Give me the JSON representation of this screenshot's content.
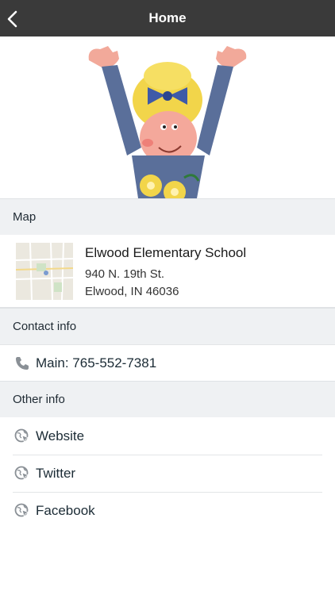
{
  "header": {
    "title": "Home",
    "back_icon": "chevron-left-icon"
  },
  "hero": {
    "alt": "school mascot illustration"
  },
  "map_section": {
    "heading": "Map",
    "school_name": "Elwood Elementary School",
    "address_line1": "940 N. 19th St.",
    "address_line2": "Elwood, IN 46036"
  },
  "contact_section": {
    "heading": "Contact info",
    "phone_label": "Main: 765-552-7381",
    "phone_icon": "phone-icon"
  },
  "other_section": {
    "heading": "Other info",
    "links": [
      {
        "label": "Website",
        "icon": "globe-cursor-icon"
      },
      {
        "label": "Twitter",
        "icon": "globe-cursor-icon"
      },
      {
        "label": "Facebook",
        "icon": "globe-cursor-icon"
      }
    ]
  },
  "colors": {
    "topbar": "#3a3a3a",
    "section_bg": "#eff1f3",
    "icon_gray": "#8a9096"
  }
}
